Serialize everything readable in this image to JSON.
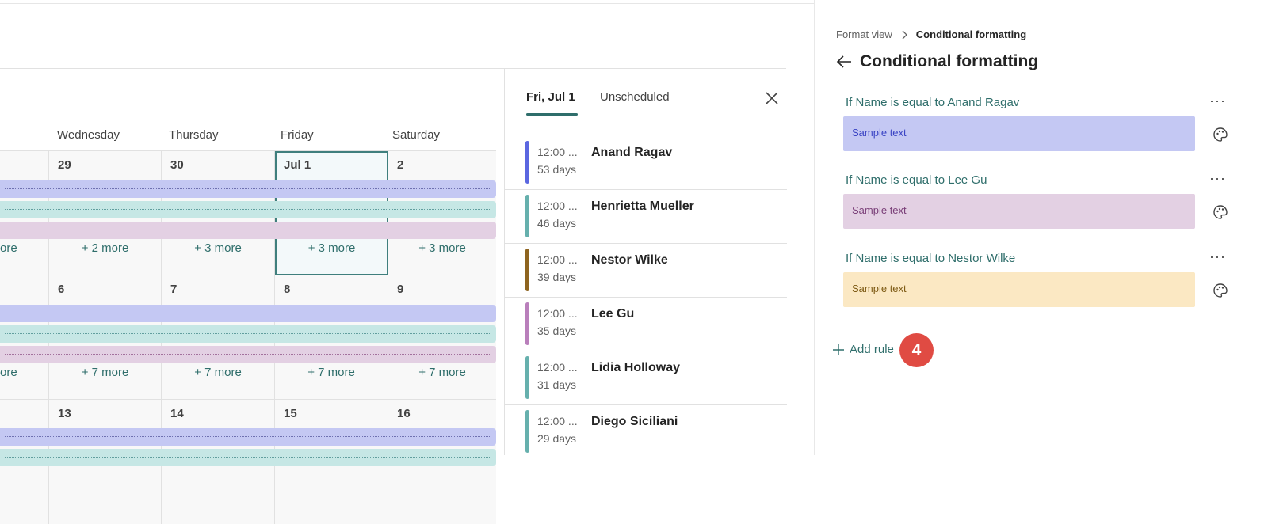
{
  "calendar": {
    "days": [
      "Wednesday",
      "Thursday",
      "Friday",
      "Saturday"
    ],
    "rows": [
      {
        "dates": [
          "29",
          "30",
          "Jul 1",
          "2"
        ],
        "first_more": "ore",
        "more": [
          "+ 2 more",
          "+ 3 more",
          "+ 3 more",
          "+ 3 more"
        ]
      },
      {
        "dates": [
          "6",
          "7",
          "8",
          "9"
        ],
        "first_more": "ore",
        "more": [
          "+ 7 more",
          "+ 7 more",
          "+ 7 more",
          "+ 7 more"
        ]
      },
      {
        "dates": [
          "13",
          "14",
          "15",
          "16"
        ]
      }
    ]
  },
  "agenda": {
    "tabs": [
      "Fri, Jul 1",
      "Unscheduled"
    ],
    "events": [
      {
        "time": "12:00 ...",
        "duration": "53 days",
        "name": "Anand Ragav",
        "color": "#5b67e0"
      },
      {
        "time": "12:00 ...",
        "duration": "46 days",
        "name": "Henrietta Mueller",
        "color": "#66b0ad"
      },
      {
        "time": "12:00 ...",
        "duration": "39 days",
        "name": "Nestor Wilke",
        "color": "#8e6420"
      },
      {
        "time": "12:00 ...",
        "duration": "35 days",
        "name": "Lee Gu",
        "color": "#b97fbb"
      },
      {
        "time": "12:00 ...",
        "duration": "31 days",
        "name": "Lidia Holloway",
        "color": "#66b0ad"
      },
      {
        "time": "12:00 ...",
        "duration": "29 days",
        "name": "Diego Siciliani",
        "color": "#66b0ad"
      }
    ]
  },
  "panel": {
    "breadcrumb_parent": "Format view",
    "breadcrumb_current": "Conditional formatting",
    "title": "Conditional formatting",
    "rules": [
      {
        "label": "If Name is equal to Anand Ragav",
        "sample": "Sample text",
        "bg": "#c4c8f3",
        "fg": "#3a44c4"
      },
      {
        "label": "If Name is equal to Lee Gu",
        "sample": "Sample text",
        "bg": "#e3d0e3",
        "fg": "#7a3f78"
      },
      {
        "label": "If Name is equal to Nestor Wilke",
        "sample": "Sample text",
        "bg": "#fbe8c3",
        "fg": "#7d5a14"
      }
    ],
    "more_label": "···",
    "add_rule": "Add rule",
    "badge": "4"
  }
}
